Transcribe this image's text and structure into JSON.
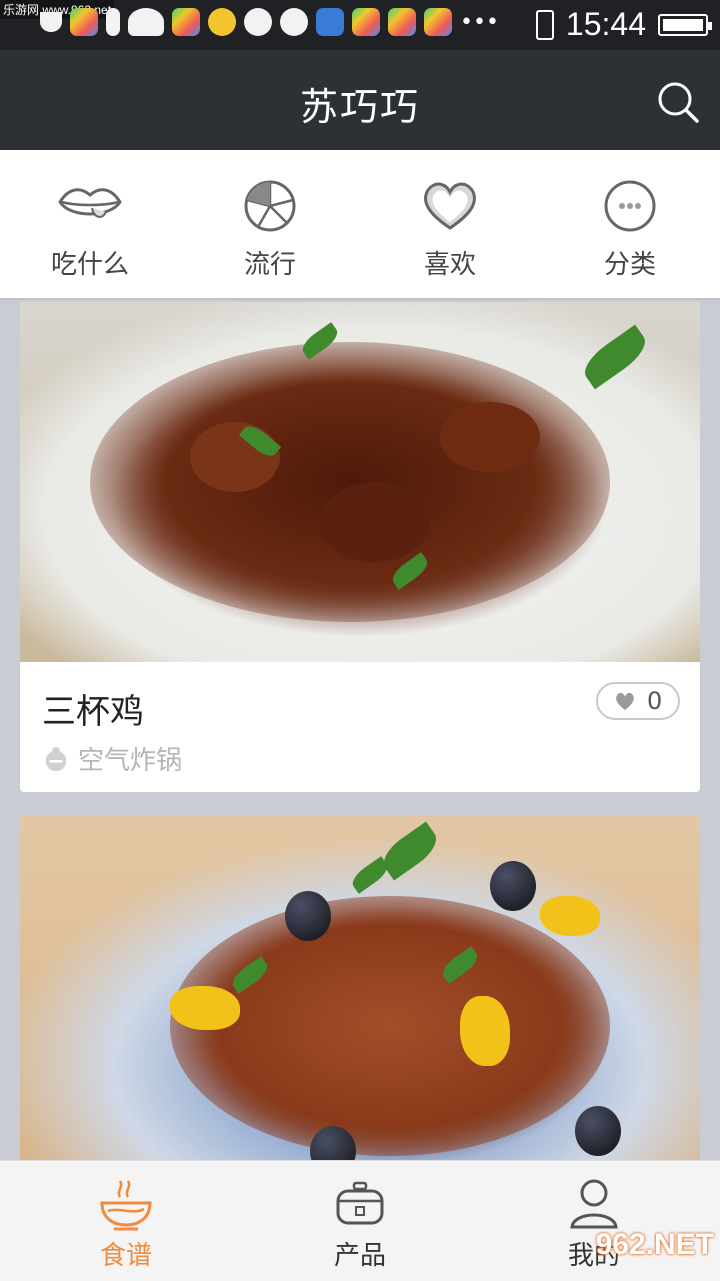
{
  "status_bar": {
    "time": "15:44",
    "watermark": "乐游网 www.962.net"
  },
  "app_bar": {
    "title": "苏巧巧",
    "search_icon": "search-icon"
  },
  "top_tabs": [
    {
      "label": "吃什么",
      "icon": "lips-icon"
    },
    {
      "label": "流行",
      "icon": "citrus-slice-icon"
    },
    {
      "label": "喜欢",
      "icon": "heart-icon"
    },
    {
      "label": "分类",
      "icon": "more-dots-icon"
    }
  ],
  "recipes": [
    {
      "name": "三杯鸡",
      "device": "空气炸锅",
      "likes": "0"
    },
    {
      "name": "",
      "device": "",
      "likes": ""
    }
  ],
  "bottom_nav": [
    {
      "label": "食谱",
      "icon": "bowl-icon",
      "active": true
    },
    {
      "label": "产品",
      "icon": "cooker-icon",
      "active": false
    },
    {
      "label": "我的",
      "icon": "user-icon",
      "active": false
    }
  ],
  "watermark_bottom": "962.NET",
  "colors": {
    "accent": "#f08a3c",
    "app_bar": "#2d3035",
    "status_bar": "#1f2124",
    "feed_background": "#c9ccd3"
  }
}
